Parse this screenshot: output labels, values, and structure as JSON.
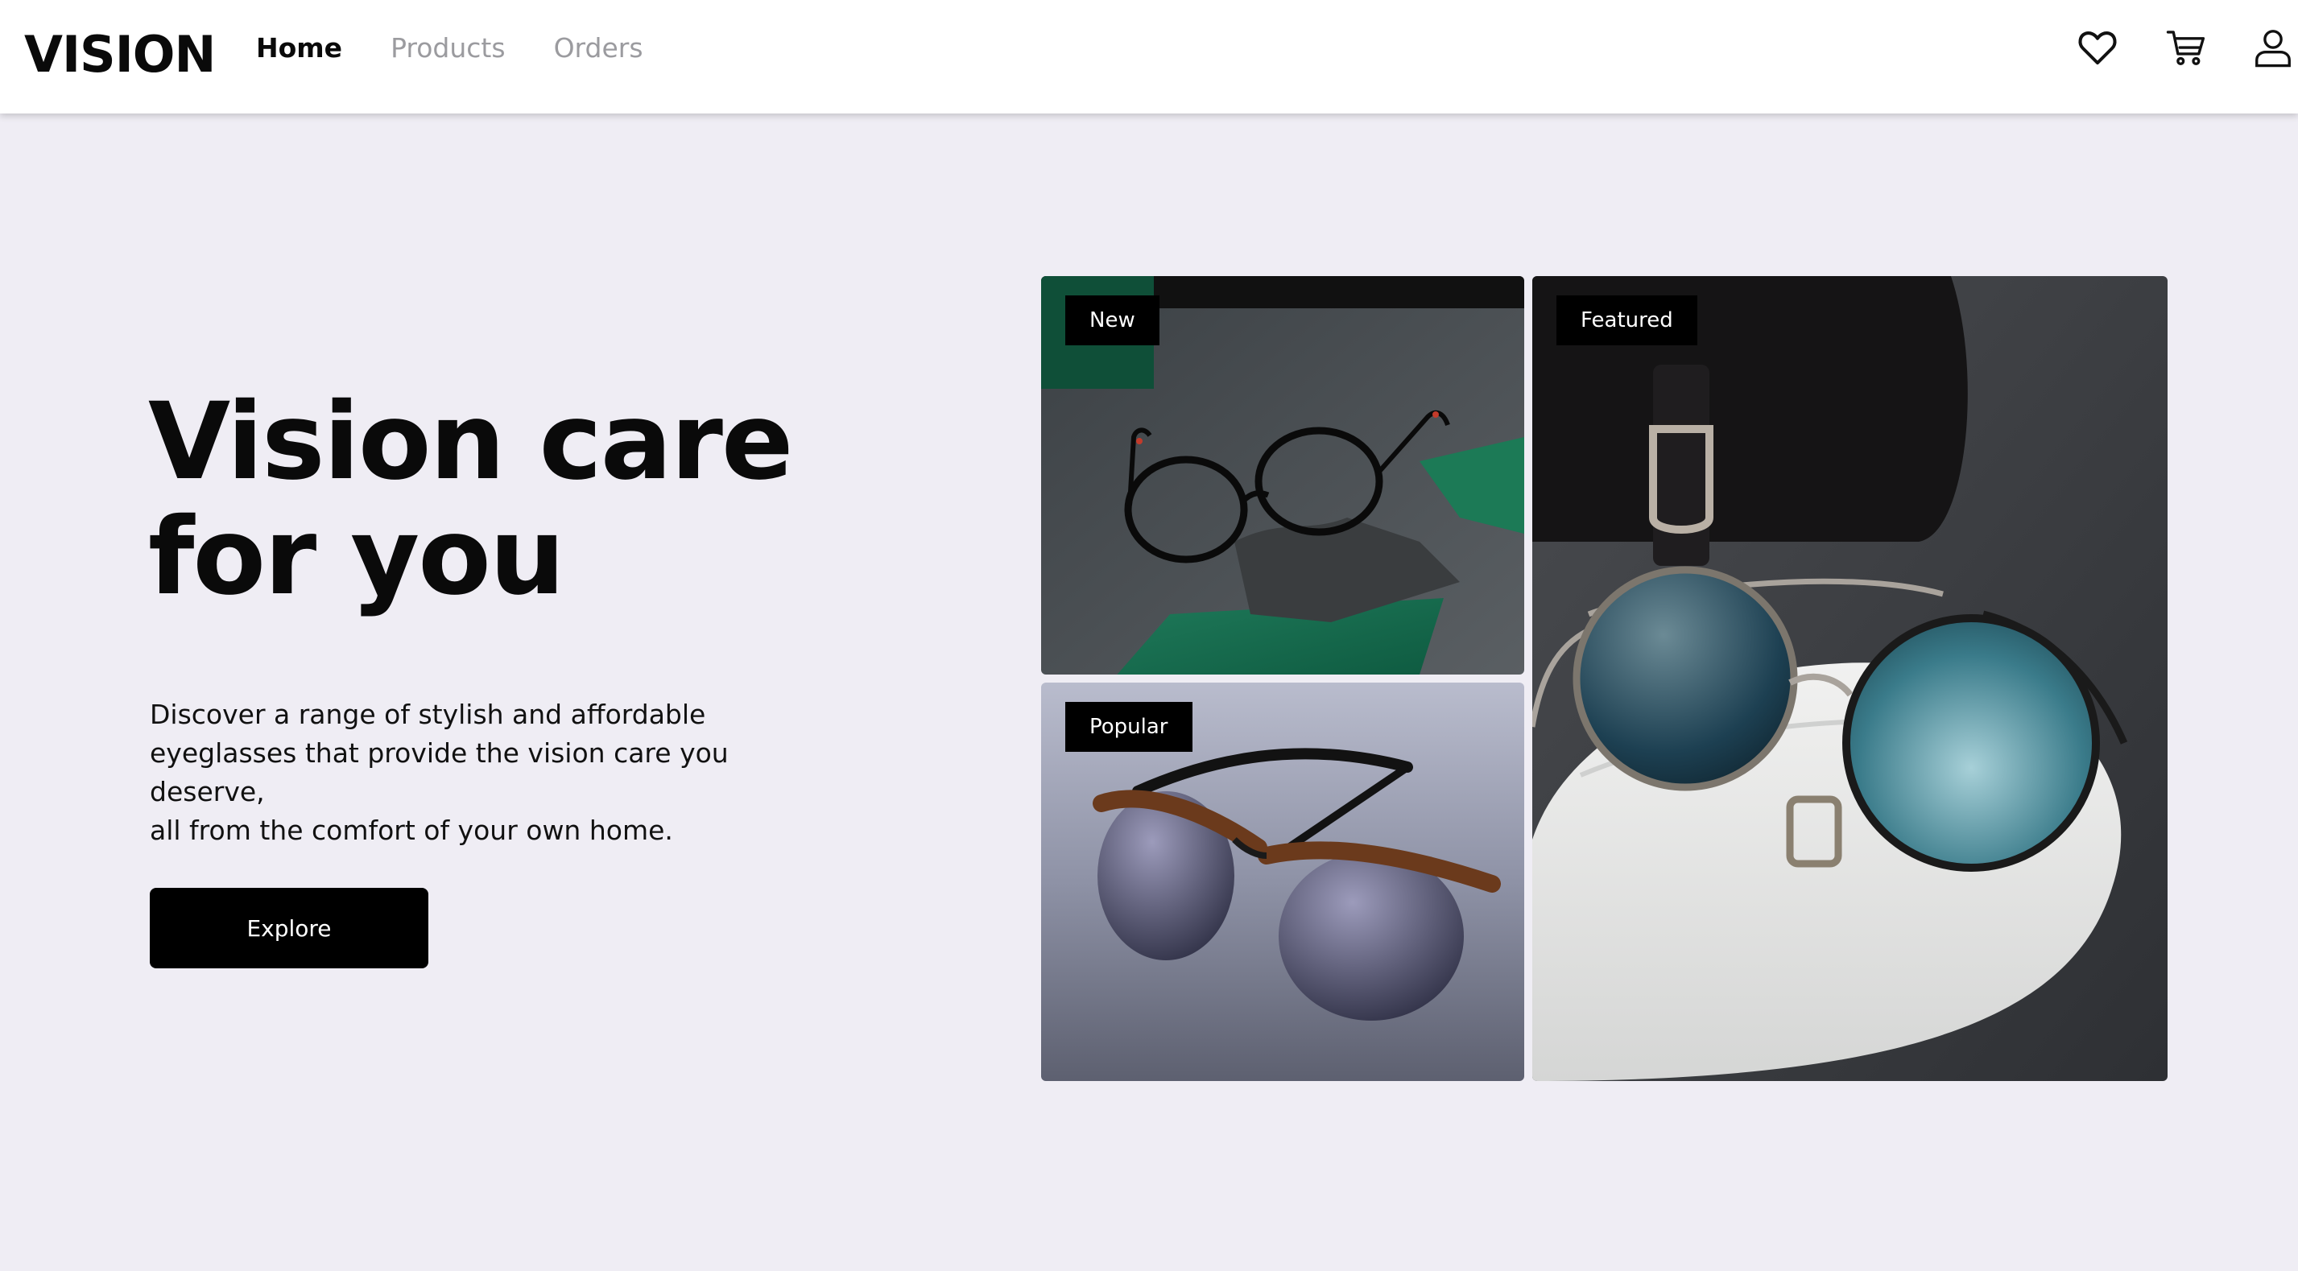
{
  "brand": {
    "logo": "VISION"
  },
  "nav": {
    "items": [
      {
        "label": "Home",
        "active": true
      },
      {
        "label": "Products",
        "active": false
      },
      {
        "label": "Orders",
        "active": false
      }
    ]
  },
  "header_icons": [
    "heart-icon",
    "cart-icon",
    "user-icon"
  ],
  "hero": {
    "title_lines": [
      "Vision care",
      "for you"
    ],
    "description_lines": [
      "Discover a range of stylish and affordable",
      "eyeglasses that provide the vision care you deserve,",
      "all from the comfort of your own home."
    ],
    "cta_label": "Explore"
  },
  "gallery": {
    "new": {
      "badge": "New"
    },
    "popular": {
      "badge": "Popular"
    },
    "featured": {
      "badge": "Featured"
    }
  },
  "colors": {
    "background": "#efedf4",
    "header": "#ffffff",
    "text": "#0a0a0a",
    "nav_inactive": "#9b9b9f",
    "button": "#000000",
    "badge": "#000000"
  }
}
